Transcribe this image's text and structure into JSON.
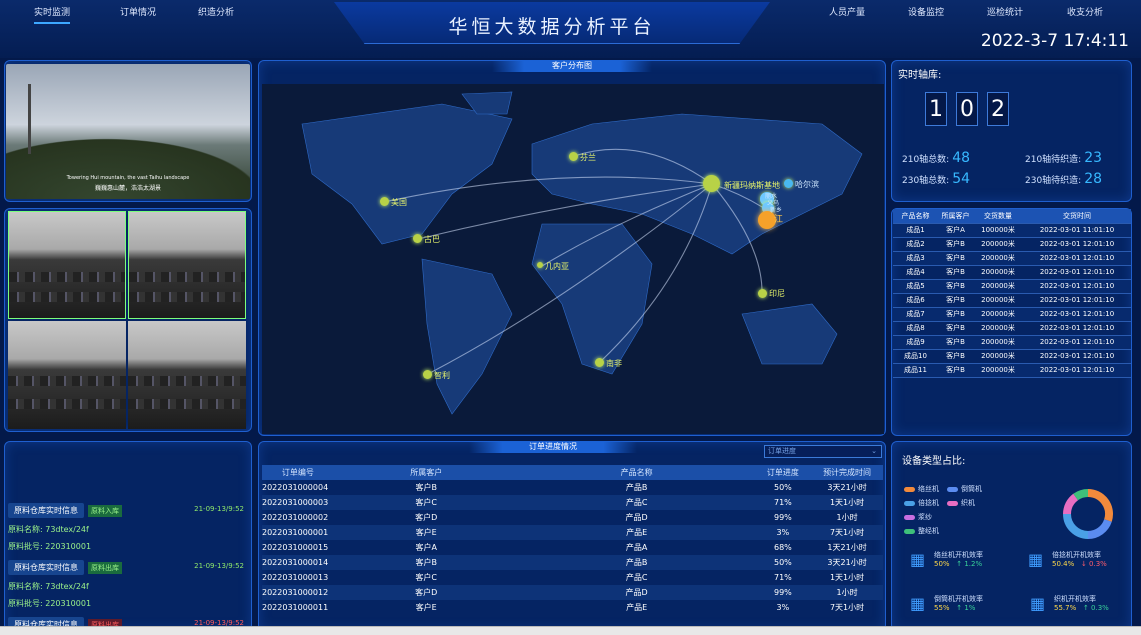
{
  "nav_left": [
    "实时监测",
    "订单情况",
    "织造分析"
  ],
  "nav_right": [
    "人员产量",
    "设备监控",
    "巡检统计",
    "收支分析"
  ],
  "title": "华恒大数据分析平台",
  "clock": "2022-3-7 17:4:11",
  "video": {
    "caption_en": "Towering Hui mountain, the vast Taihu landscape",
    "caption_zh": "巍巍惠山麓，浩浩太湖景"
  },
  "map": {
    "title": "客户分布图",
    "cities": [
      "新疆玛纳斯基地",
      "哈尔滨",
      "江",
      "印尼",
      "芬兰",
      "美国",
      "古巴",
      "几内亚",
      "南非",
      "智利",
      "丽水",
      "义乌",
      "新乡"
    ]
  },
  "realtime": {
    "title": "实时轴库:",
    "digits": [
      "1",
      "0",
      "2"
    ],
    "stats": [
      {
        "label": "210轴总数:",
        "value": "48"
      },
      {
        "label": "210轴待织造:",
        "value": "23"
      },
      {
        "label": "230轴总数:",
        "value": "54"
      },
      {
        "label": "230轴待织造:",
        "value": "28"
      }
    ]
  },
  "stock": {
    "headers": [
      "产品名称",
      "所属客户",
      "交货数量",
      "交货时间"
    ],
    "rows": [
      [
        "成品1",
        "客户A",
        "100000米",
        "2022-03-01 11:01:10"
      ],
      [
        "成品2",
        "客户B",
        "200000米",
        "2022-03-01 12:01:10"
      ],
      [
        "成品3",
        "客户B",
        "200000米",
        "2022-03-01 12:01:10"
      ],
      [
        "成品4",
        "客户B",
        "200000米",
        "2022-03-01 12:01:10"
      ],
      [
        "成品5",
        "客户B",
        "200000米",
        "2022-03-01 12:01:10"
      ],
      [
        "成品6",
        "客户B",
        "200000米",
        "2022-03-01 12:01:10"
      ],
      [
        "成品7",
        "客户B",
        "200000米",
        "2022-03-01 12:01:10"
      ],
      [
        "成品8",
        "客户B",
        "200000米",
        "2022-03-01 12:01:10"
      ],
      [
        "成品9",
        "客户B",
        "200000米",
        "2022-03-01 12:01:10"
      ],
      [
        "成品10",
        "客户B",
        "200000米",
        "2022-03-01 12:01:10"
      ],
      [
        "成品11",
        "客户B",
        "200000米",
        "2022-03-01 12:01:10"
      ]
    ]
  },
  "orders": {
    "title": "订单进度情况",
    "select_placeholder": "订单进度",
    "headers": [
      "订单编号",
      "所属客户",
      "产品名称",
      "订单进度",
      "预计完成时间"
    ],
    "rows": [
      [
        "2022031000004",
        "客户B",
        "产品B",
        "50%",
        "3天21小时"
      ],
      [
        "2022031000003",
        "客户C",
        "产品C",
        "71%",
        "1天1小时"
      ],
      [
        "2022031000002",
        "客户D",
        "产品D",
        "99%",
        "1小时"
      ],
      [
        "2022031000001",
        "客户E",
        "产品E",
        "3%",
        "7天1小时"
      ],
      [
        "2022031000015",
        "客户A",
        "产品A",
        "68%",
        "1天21小时"
      ],
      [
        "2022031000014",
        "客户B",
        "产品B",
        "50%",
        "3天21小时"
      ],
      [
        "2022031000013",
        "客户C",
        "产品C",
        "71%",
        "1天1小时"
      ],
      [
        "2022031000012",
        "客户D",
        "产品D",
        "99%",
        "1小时"
      ],
      [
        "2022031000011",
        "客户E",
        "产品E",
        "3%",
        "7天1小时"
      ]
    ]
  },
  "raw": [
    {
      "head": "原料仓库实时信息",
      "badge": "原料入库",
      "date": "21-09-13/9:52",
      "name": "原料名称:  73dtex/24f",
      "batch": "原料批号:  220310001"
    },
    {
      "head": "原料仓库实时信息",
      "badge": "原料出库",
      "date": "21-09-13/9:52",
      "name": "原料名称:  73dtex/24f",
      "batch": "原料批号:  220310001"
    },
    {
      "head": "原料仓库实时信息",
      "badge": "原料出库",
      "date": "21-09-13/9:52"
    }
  ],
  "devices": {
    "title": "设备类型占比:",
    "legend": [
      {
        "name": "络丝机",
        "color": "#f28a3c"
      },
      {
        "name": "倒筒机",
        "color": "#5b8cf0"
      },
      {
        "name": "倍捻机",
        "color": "#4aa0e6"
      },
      {
        "name": "织机",
        "color": "#e86ec2"
      },
      {
        "name": "浆纱",
        "color": "#c86ee0"
      },
      {
        "name": "整经机",
        "color": "#3ec07a"
      }
    ],
    "pie": [
      {
        "value": 30,
        "color": "#f28a3c"
      },
      {
        "value": 20,
        "color": "#5b8cf0"
      },
      {
        "value": 25,
        "color": "#4aa0e6"
      },
      {
        "value": 15,
        "color": "#e86ec2"
      },
      {
        "value": 10,
        "color": "#3ec07a"
      }
    ],
    "metrics": [
      {
        "name": "络丝机开机效率",
        "value": "50%",
        "delta": "↑ 1.2%",
        "dir": "up"
      },
      {
        "name": "倍捻机开机效率",
        "value": "50.4%",
        "delta": "↓ 0.3%",
        "dir": "down"
      },
      {
        "name": "倒筒机开机效率",
        "value": "55%",
        "delta": "↑ 1%",
        "dir": "up"
      },
      {
        "name": "织机开机效率",
        "value": "55.7%",
        "delta": "↑ 0.3%",
        "dir": "up"
      }
    ]
  }
}
